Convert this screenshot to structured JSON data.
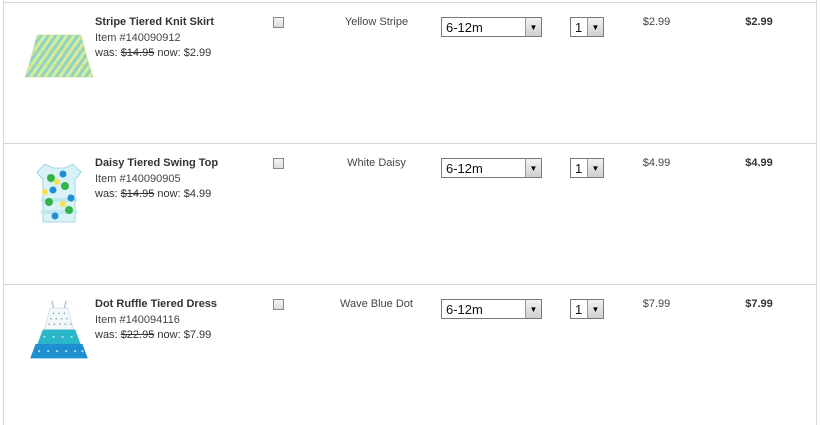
{
  "rows": [
    {
      "name": "Stripe Tiered Knit Skirt",
      "item": "Item #140090912",
      "was_label": "was:",
      "was_price": "$14.95",
      "now_label": "now:",
      "now_price": "$2.99",
      "color": "Yellow Stripe",
      "size": "6-12m",
      "qty": "1",
      "unit_price": "$2.99",
      "total": "$2.99",
      "image": "stripe-skirt-image"
    },
    {
      "name": "Daisy Tiered Swing Top",
      "item": "Item #140090905",
      "was_label": "was:",
      "was_price": "$14.95",
      "now_label": "now:",
      "now_price": "$4.99",
      "color": "White Daisy",
      "size": "6-12m",
      "qty": "1",
      "unit_price": "$4.99",
      "total": "$4.99",
      "image": "daisy-top-image"
    },
    {
      "name": "Dot Ruffle Tiered Dress",
      "item": "Item #140094116",
      "was_label": "was:",
      "was_price": "$22.95",
      "now_label": "now:",
      "now_price": "$7.99",
      "color": "Wave Blue Dot",
      "size": "6-12m",
      "qty": "1",
      "unit_price": "$7.99",
      "total": "$7.99",
      "image": "dot-dress-image"
    }
  ],
  "icons": {
    "select_arrow": "chevron-down-icon"
  }
}
